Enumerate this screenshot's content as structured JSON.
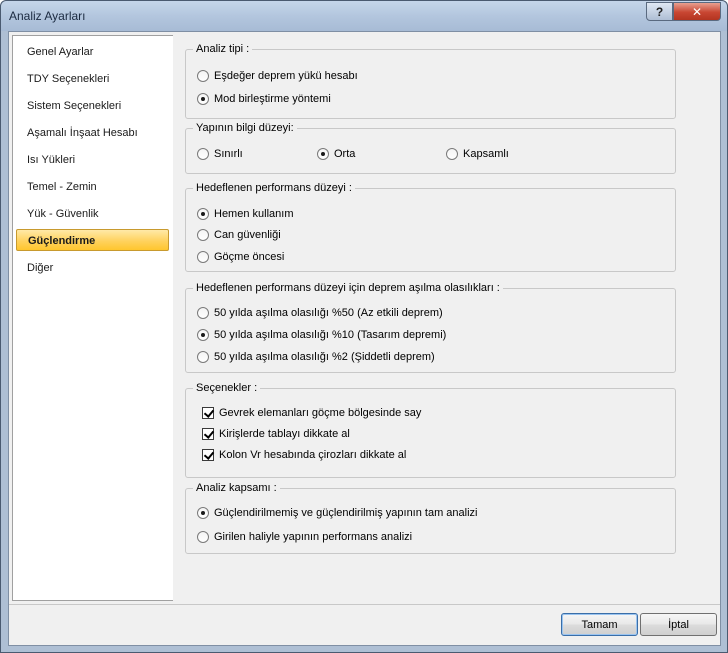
{
  "window": {
    "title": "Analiz Ayarları",
    "help": "?",
    "close": "✕"
  },
  "sidebar": {
    "items": [
      {
        "label": "Genel Ayarlar",
        "active": false
      },
      {
        "label": "TDY Seçenekleri",
        "active": false
      },
      {
        "label": "Sistem Seçenekleri",
        "active": false
      },
      {
        "label": "Aşamalı İnşaat Hesabı",
        "active": false
      },
      {
        "label": "Isı Yükleri",
        "active": false
      },
      {
        "label": "Temel - Zemin",
        "active": false
      },
      {
        "label": "Yük - Güvenlik",
        "active": false
      },
      {
        "label": "Güçlendirme",
        "active": true
      },
      {
        "label": "Diğer",
        "active": false
      }
    ]
  },
  "groups": {
    "analiz_tipi": {
      "title": "Analiz tipi :",
      "options": [
        {
          "label": "Eşdeğer deprem yükü hesabı",
          "selected": false
        },
        {
          "label": "Mod birleştirme yöntemi",
          "selected": true
        }
      ]
    },
    "bilgi_duzeyi": {
      "title": "Yapının bilgi düzeyi:",
      "options": [
        {
          "label": "Sınırlı",
          "selected": false
        },
        {
          "label": "Orta",
          "selected": true
        },
        {
          "label": "Kapsamlı",
          "selected": false
        }
      ]
    },
    "performans": {
      "title": "Hedeflenen performans düzeyi :",
      "options": [
        {
          "label": "Hemen kullanım",
          "selected": true
        },
        {
          "label": "Can güvenliği",
          "selected": false
        },
        {
          "label": "Göçme öncesi",
          "selected": false
        }
      ]
    },
    "asilma": {
      "title": "Hedeflenen performans düzeyi için deprem aşılma olasılıkları :",
      "options": [
        {
          "label": "50 yılda aşılma olasılığı %50 (Az etkili deprem)",
          "selected": false
        },
        {
          "label": "50 yılda aşılma olasılığı %10 (Tasarım depremi)",
          "selected": true
        },
        {
          "label": "50 yılda aşılma olasılığı %2  (Şiddetli deprem)",
          "selected": false
        }
      ]
    },
    "secenekler": {
      "title": "Seçenekler :",
      "options": [
        {
          "label": "Gevrek elemanları göçme bölgesinde say",
          "checked": true
        },
        {
          "label": "Kirişlerde tablayı dikkate al",
          "checked": true
        },
        {
          "label": "Kolon Vr hesabında çirozları dikkate al",
          "checked": true
        }
      ]
    },
    "kapsam": {
      "title": "Analiz kapsamı :",
      "options": [
        {
          "label": "Güçlendirilmemiş ve güçlendirilmiş yapının tam analizi",
          "selected": true
        },
        {
          "label": "Girilen haliyle yapının performans analizi",
          "selected": false
        }
      ]
    }
  },
  "buttons": {
    "ok": "Tamam",
    "cancel": "İptal"
  }
}
